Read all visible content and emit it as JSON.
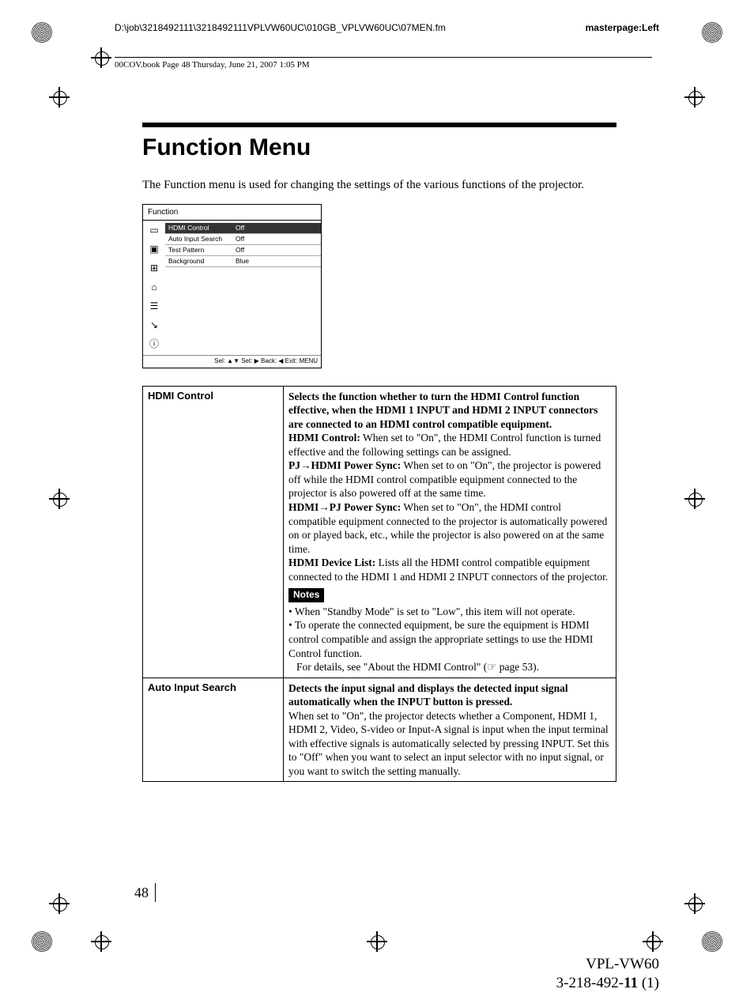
{
  "header": {
    "path": "D:\\job\\3218492111\\3218492111VPLVW60UC\\010GB_VPLVW60UC\\07MEN.fm",
    "masterpage": "masterpage:Left",
    "cov_line": "00COV.book  Page 48  Thursday, June 21, 2007  1:05 PM"
  },
  "title": "Function Menu",
  "intro": "The Function menu is used for changing the settings of the various functions of the projector.",
  "menu": {
    "title": "Function",
    "footer": "Sel: ▲▼   Set: ▶   Back: ◀   Exit: MENU",
    "rows": [
      {
        "label": "HDMI Control",
        "value": "Off",
        "selected": true
      },
      {
        "label": "Auto Input Search",
        "value": "Off",
        "selected": false
      },
      {
        "label": "Test Pattern",
        "value": "Off",
        "selected": false
      },
      {
        "label": "Background",
        "value": "Blue",
        "selected": false
      }
    ]
  },
  "table": {
    "row1": {
      "label": "HDMI Control",
      "lead": "Selects the function whether to turn the HDMI Control function effective, when the HDMI 1 INPUT and HDMI 2 INPUT connectors are connected to an HDMI control compatible equipment.",
      "items": {
        "hdmi_control_label": "HDMI Control:",
        "hdmi_control_text": " When set to \"On\", the HDMI Control function is turned effective and the following settings can be assigned.",
        "pj_hdmi_label": "PJ→HDMI Power Sync:",
        "pj_hdmi_text": " When set to on \"On\", the projector is powered off while the HDMI control compatible equipment connected to the projector is also powered off at the same time.",
        "hdmi_pj_label": "HDMI→PJ Power Sync:",
        "hdmi_pj_text": " When set to \"On\", the HDMI control compatible equipment connected to the projector is automatically powered on or played back, etc., while the projector is also powered on at the same time.",
        "devlist_label": "HDMI Device List:",
        "devlist_text": " Lists all the HDMI control compatible equipment connected to the HDMI 1 and HDMI 2 INPUT connectors of the projector."
      },
      "notes_label": "Notes",
      "notes": [
        "When \"Standby Mode\" is set to \"Low\", this item will not operate.",
        "To operate the connected equipment, be sure the equipment is HDMI control compatible and assign the appropriate settings to use the HDMI Control function."
      ],
      "note_ref": "For details, see \"About the HDMI Control\" (☞ page 53)."
    },
    "row2": {
      "label": "Auto Input Search",
      "lead": "Detects the input signal and displays the detected input signal automatically when the INPUT button is pressed.",
      "body": "When set to \"On\", the projector detects whether a Component, HDMI 1, HDMI 2, Video, S-video or Input-A signal is input when the input terminal with effective signals is automatically selected by pressing INPUT. Set this to \"Off\" when you want to select an input selector with no input signal, or you want to switch the setting manually."
    }
  },
  "page_number": "48",
  "footer": {
    "model": "VPL-VW60",
    "doc_number_pre": "3-218-492-",
    "doc_number_bold": "11",
    "doc_number_post": " (1)"
  }
}
